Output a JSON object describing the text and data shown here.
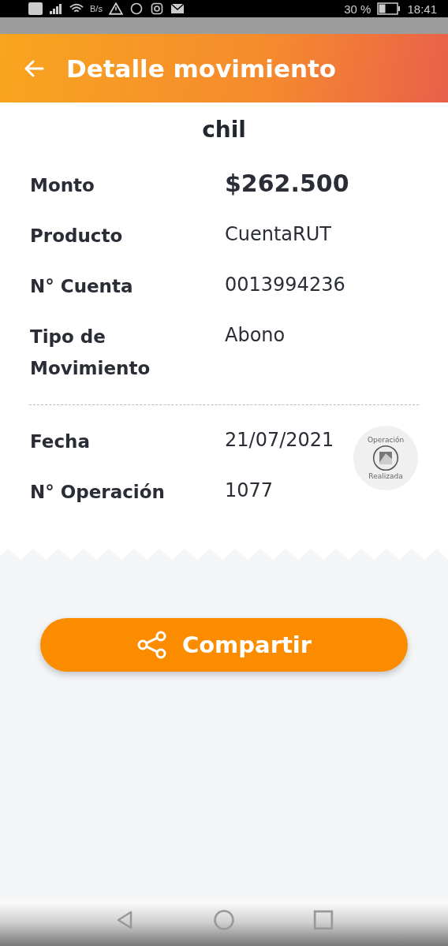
{
  "status_bar": {
    "speed_unit": "B/s",
    "battery": "30 %",
    "time": "18:41"
  },
  "header": {
    "title": "Detalle movimiento"
  },
  "receipt": {
    "title_fragment": "chil",
    "details": [
      {
        "label": "Monto",
        "value": "$262.500",
        "emphasis": true
      },
      {
        "label": "Producto",
        "value": "CuentaRUT",
        "emphasis": false
      },
      {
        "label": "N° Cuenta",
        "value": "0013994236",
        "emphasis": false
      },
      {
        "label": "Tipo de Movimiento",
        "value": "Abono",
        "emphasis": false
      }
    ],
    "operation": [
      {
        "label": "Fecha",
        "value": "21/07/2021"
      },
      {
        "label": "N° Operación",
        "value": "1077"
      }
    ],
    "stamp": {
      "top": "Operación",
      "bottom": "Realizada"
    }
  },
  "share_button": {
    "label": "Compartir"
  }
}
